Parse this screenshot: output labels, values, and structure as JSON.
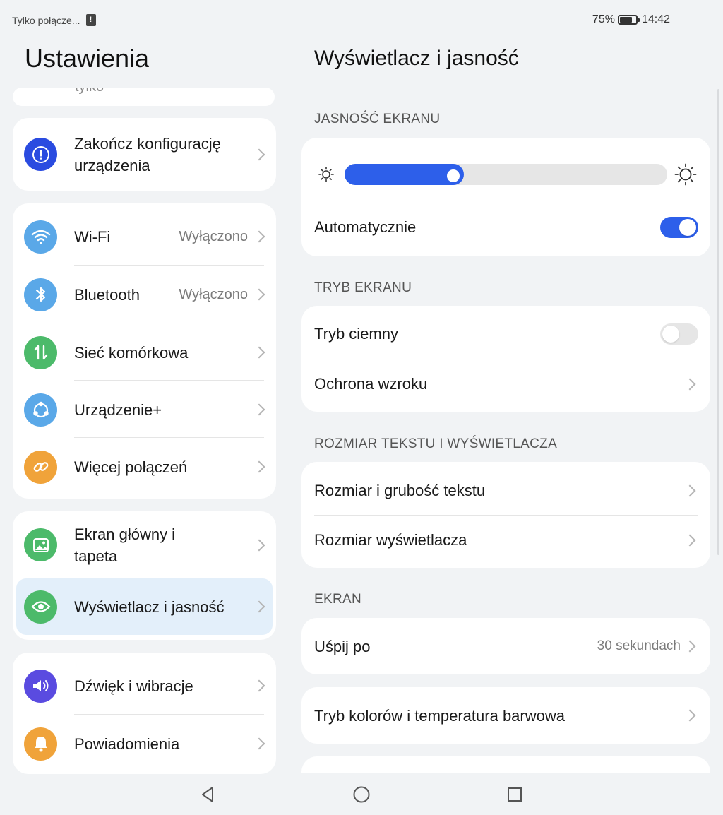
{
  "status": {
    "carrier": "Tylko połącze...",
    "sim_icon": "!",
    "battery_percent": "75%",
    "time": "14:42"
  },
  "left": {
    "title": "Ustawienia",
    "peek_text": "tylko",
    "setup": {
      "label": "Zakończ konfigurację urządzenia",
      "icon": "alert-icon",
      "color": "#2a4be0"
    },
    "connectivity": [
      {
        "label": "Wi-Fi",
        "value": "Wyłączono",
        "icon": "wifi-icon",
        "color": "#5aa8e8"
      },
      {
        "label": "Bluetooth",
        "value": "Wyłączono",
        "icon": "bluetooth-icon",
        "color": "#5aa8e8"
      },
      {
        "label": "Sieć komórkowa",
        "value": "",
        "icon": "mobile-data-icon",
        "color": "#4cba6a"
      },
      {
        "label": "Urządzenie+",
        "value": "",
        "icon": "device-plus-icon",
        "color": "#5aa8e8"
      },
      {
        "label": "Więcej połączeń",
        "value": "",
        "icon": "link-icon",
        "color": "#f0a33a"
      }
    ],
    "display": [
      {
        "label": "Ekran główny i tapeta",
        "icon": "wallpaper-icon",
        "color": "#4cba6a"
      },
      {
        "label": "Wyświetlacz i jasność",
        "icon": "eye-icon",
        "color": "#4cba6a",
        "selected": true
      }
    ],
    "sound": [
      {
        "label": "Dźwięk i wibracje",
        "icon": "speaker-icon",
        "color": "#5a4be0"
      },
      {
        "label": "Powiadomienia",
        "icon": "bell-icon",
        "color": "#f0a33a"
      }
    ]
  },
  "right": {
    "title": "Wyświetlacz i jasność",
    "sections": {
      "brightness": "JASNOŚĆ EKRANU",
      "mode": "TRYB EKRANU",
      "text_size": "ROZMIAR TEKSTU I WYŚWIETLACZA",
      "screen": "EKRAN"
    },
    "brightness": {
      "level": 0.37,
      "auto_label": "Automatycznie",
      "auto_on": true
    },
    "mode": {
      "dark_label": "Tryb ciemny",
      "dark_on": false,
      "eye_label": "Ochrona wzroku"
    },
    "text_size": {
      "text_label": "Rozmiar i grubość tekstu",
      "display_label": "Rozmiar wyświetlacza"
    },
    "screen": {
      "sleep_label": "Uśpij po",
      "sleep_value": "30 sekundach",
      "color_label": "Tryb kolorów i temperatura barwowa"
    }
  },
  "nav": {
    "back": "back-icon",
    "home": "home-icon",
    "recents": "recents-icon"
  },
  "colors": {
    "accent": "#2d5fea",
    "selected_bg": "#e3effa",
    "bg": "#f1f3f5"
  }
}
